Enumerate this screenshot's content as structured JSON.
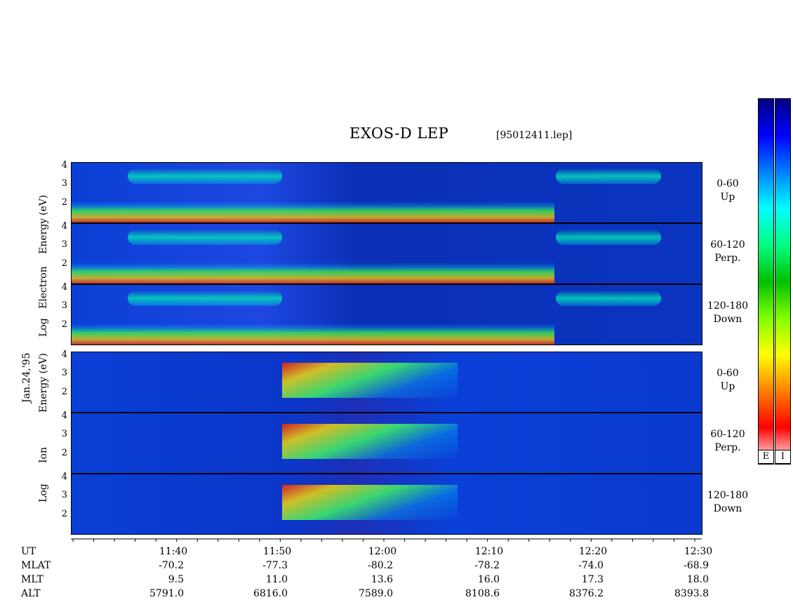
{
  "title": "EXOS-D LEP",
  "filename": "[95012411.lep]",
  "date_label": "Jan.24,'95",
  "electron_axis_label": [
    "Log",
    "Electron",
    "Energy"
  ],
  "ion_axis_label": [
    "Log",
    "Ion",
    "Energy (eV)"
  ],
  "electron_axis_unit": "(eV)",
  "y_ticks": [
    "4",
    "3",
    "2"
  ],
  "panels": [
    {
      "label1": "0-60",
      "label2": "Up"
    },
    {
      "label1": "60-120",
      "label2": "Perp."
    },
    {
      "label1": "120-180",
      "label2": "Down"
    },
    {
      "label1": "0-60",
      "label2": "Up"
    },
    {
      "label1": "60-120",
      "label2": "Perp."
    },
    {
      "label1": "120-180",
      "label2": "Down"
    }
  ],
  "colorbar": {
    "electron_label": "E",
    "ion_label": "I",
    "colors": [
      "#000080",
      "#0000ff",
      "#0080ff",
      "#00ffff",
      "#00ff80",
      "#00c000",
      "#80ff00",
      "#ffff00",
      "#ff8000",
      "#ff0000",
      "#ffffff"
    ]
  },
  "footer": {
    "row_names": [
      "UT",
      "MLAT",
      "MLT",
      "ALT"
    ],
    "ut": [
      "11:40",
      "11:50",
      "12:00",
      "12:10",
      "12:20",
      "12:30"
    ],
    "mlat": [
      "-70.2",
      "-77.3",
      "-80.2",
      "-78.2",
      "-74.0",
      "-68.9"
    ],
    "mlt": [
      "9.5",
      "11.0",
      "13.6",
      "16.0",
      "17.3",
      "18.0"
    ],
    "alt": [
      "5791.0",
      "6816.0",
      "7589.0",
      "8108.6",
      "8376.2",
      "8393.8"
    ]
  },
  "chart_data": {
    "type": "heatmap",
    "title": "EXOS-D LEP",
    "subtitle": "[95012411.lep]",
    "x_axis": "UT",
    "x_ticks": [
      "11:40",
      "11:50",
      "12:00",
      "12:10",
      "12:20",
      "12:30"
    ],
    "ylim": [
      1,
      4
    ],
    "y_ticks": [
      2,
      3,
      4
    ],
    "series": [
      {
        "name": "Electron 0-60 Up"
      },
      {
        "name": "Electron 60-120 Perp."
      },
      {
        "name": "Electron 120-180 Down"
      },
      {
        "name": "Ion 0-60 Up"
      },
      {
        "name": "Ion 60-120 Perp."
      },
      {
        "name": "Ion 120-180 Down"
      }
    ]
  }
}
